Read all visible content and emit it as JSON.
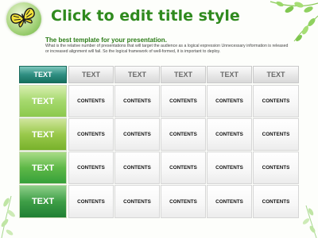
{
  "slide": {
    "title": "Click to edit title style",
    "subtitle": "The best template for your presentation.",
    "body": "What is the relative number of presentations that will target the audience as a logical expression Unnecessary information is released or increased alignment will fail. So the logical framework of well-formed, it is important to deploy."
  },
  "table": {
    "header": [
      "TEXT",
      "TEXT",
      "TEXT",
      "TEXT",
      "TEXT",
      "TEXT"
    ],
    "rows": [
      {
        "label": "TEXT",
        "cells": [
          "CONTENTS",
          "CONTENTS",
          "CONTENTS",
          "CONTENTS",
          "CONTENTS"
        ]
      },
      {
        "label": "TEXT",
        "cells": [
          "CONTENTS",
          "CONTENTS",
          "CONTENTS",
          "CONTENTS",
          "CONTENTS"
        ]
      },
      {
        "label": "TEXT",
        "cells": [
          "CONTENTS",
          "CONTENTS",
          "CONTENTS",
          "CONTENTS",
          "CONTENTS"
        ]
      },
      {
        "label": "TEXT",
        "cells": [
          "CONTENTS",
          "CONTENTS",
          "CONTENTS",
          "CONTENTS",
          "CONTENTS"
        ]
      }
    ]
  },
  "decor": {
    "badge_icon": "butterfly-icon",
    "leaf_icon": "leaf-icon",
    "accent_color": "#2f8a1e"
  }
}
